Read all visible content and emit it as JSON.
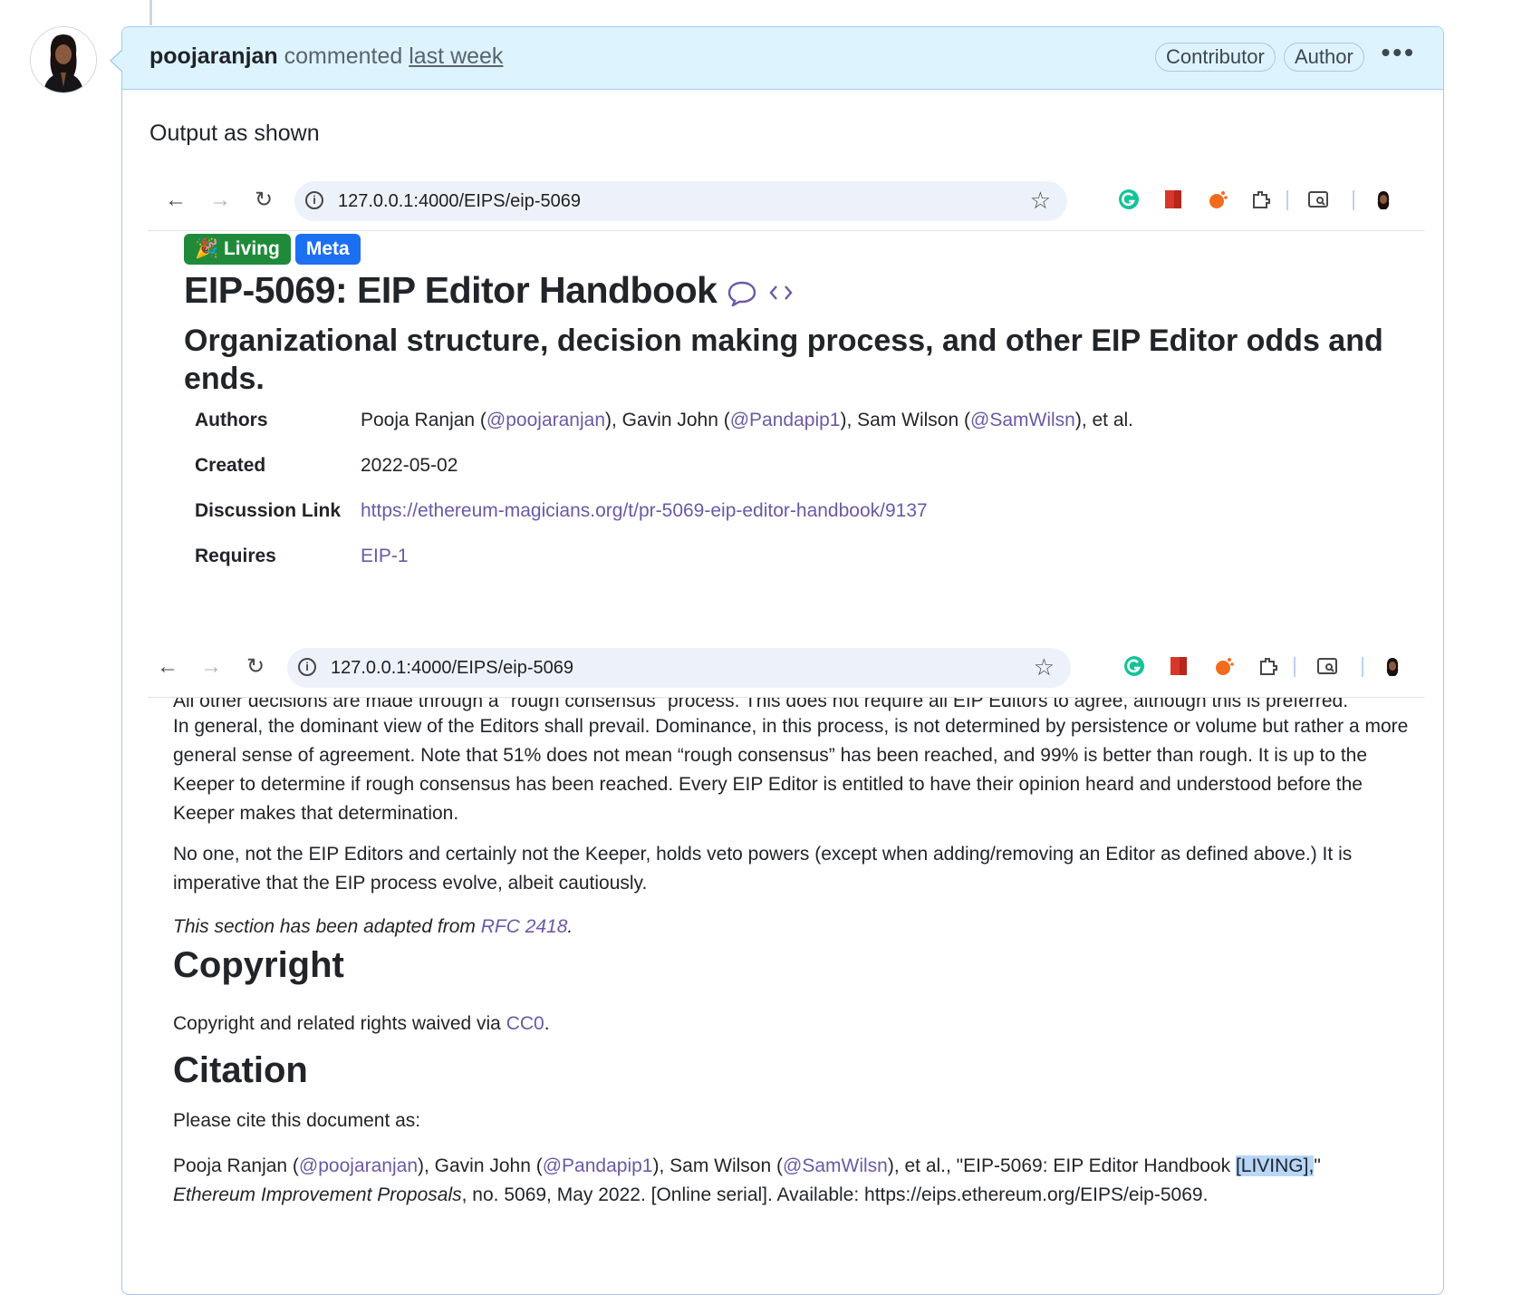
{
  "comment": {
    "username": "poojaranjan",
    "action": "commented",
    "time": "last week",
    "badges": [
      "Contributor",
      "Author"
    ],
    "more_icon": "kebab-horizontal-icon",
    "body": "Output as shown"
  },
  "browser": {
    "url": "127.0.0.1:4000/EIPS/eip-5069",
    "icons": [
      "back-arrow-icon",
      "forward-arrow-icon",
      "reload-icon",
      "site-info-icon",
      "star-icon",
      "grammarly-icon",
      "bookmark-ext-icon",
      "hand-ext-icon",
      "puzzle-extensions-icon",
      "tab-search-icon",
      "profile-avatar-icon"
    ]
  },
  "eip": {
    "badge_status": "Living",
    "badge_category": "Meta",
    "title": "EIP-5069: EIP Editor Handbook",
    "subtitle": "Organizational structure, decision making process, and other EIP Editor odds and ends.",
    "meta": {
      "authors_label": "Authors",
      "authors_pre1": "Pooja Ranjan (",
      "author1_handle": "@poojaranjan",
      "authors_pre2": "), Gavin John (",
      "author2_handle": "@Pandapip1",
      "authors_pre3": "), Sam Wilson (",
      "author3_handle": "@SamWilsn",
      "authors_post": "), et al.",
      "created_label": "Created",
      "created_value": "2022-05-02",
      "discussion_label": "Discussion Link",
      "discussion_value": "https://ethereum-magicians.org/t/pr-5069-eip-editor-handbook/9137",
      "requires_label": "Requires",
      "requires_value": "EIP-1"
    }
  },
  "page2": {
    "cut_line": "All other decisions are made through a \"rough consensus\" process. This does not require all EIP Editors to agree, although this is preferred.",
    "para1": "In general, the dominant view of the Editors shall prevail. Dominance, in this process, is not determined by persistence or volume but rather a more general sense of agreement. Note that 51% does not mean “rough consensus” has been reached, and 99% is better than rough. It is up to the Keeper to determine if rough consensus has been reached. Every EIP Editor is entitled to have their opinion heard and understood before the Keeper makes that determination.",
    "para2": "No one, not the EIP Editors and certainly not the Keeper, holds veto powers (except when adding/removing an Editor as defined above.) It is imperative that the EIP process evolve, albeit cautiously.",
    "adapted_pre": "This section has been adapted from ",
    "adapted_link": "RFC 2418",
    "adapted_post": ".",
    "copyright_heading": "Copyright",
    "copyright_pre": "Copyright and related rights waived via ",
    "copyright_link": "CC0",
    "copyright_post": ".",
    "citation_heading": "Citation",
    "citation_intro": "Please cite this document as:",
    "cite_pre1": "Pooja Ranjan (",
    "cite_h1": "@poojaranjan",
    "cite_pre2": "), Gavin John (",
    "cite_h2": "@Pandapip1",
    "cite_pre3": "), Sam Wilson (",
    "cite_h3": "@SamWilsn",
    "cite_pre4": "), et al., \"EIP-5069: EIP Editor Handbook ",
    "cite_highlight": "[LIVING],",
    "cite_post4": "\"",
    "cite_journal": "Ethereum Improvement Proposals",
    "cite_rest": ", no. 5069, May 2022. [Online serial]. Available: https://eips.ethereum.org/EIPS/eip-5069."
  }
}
